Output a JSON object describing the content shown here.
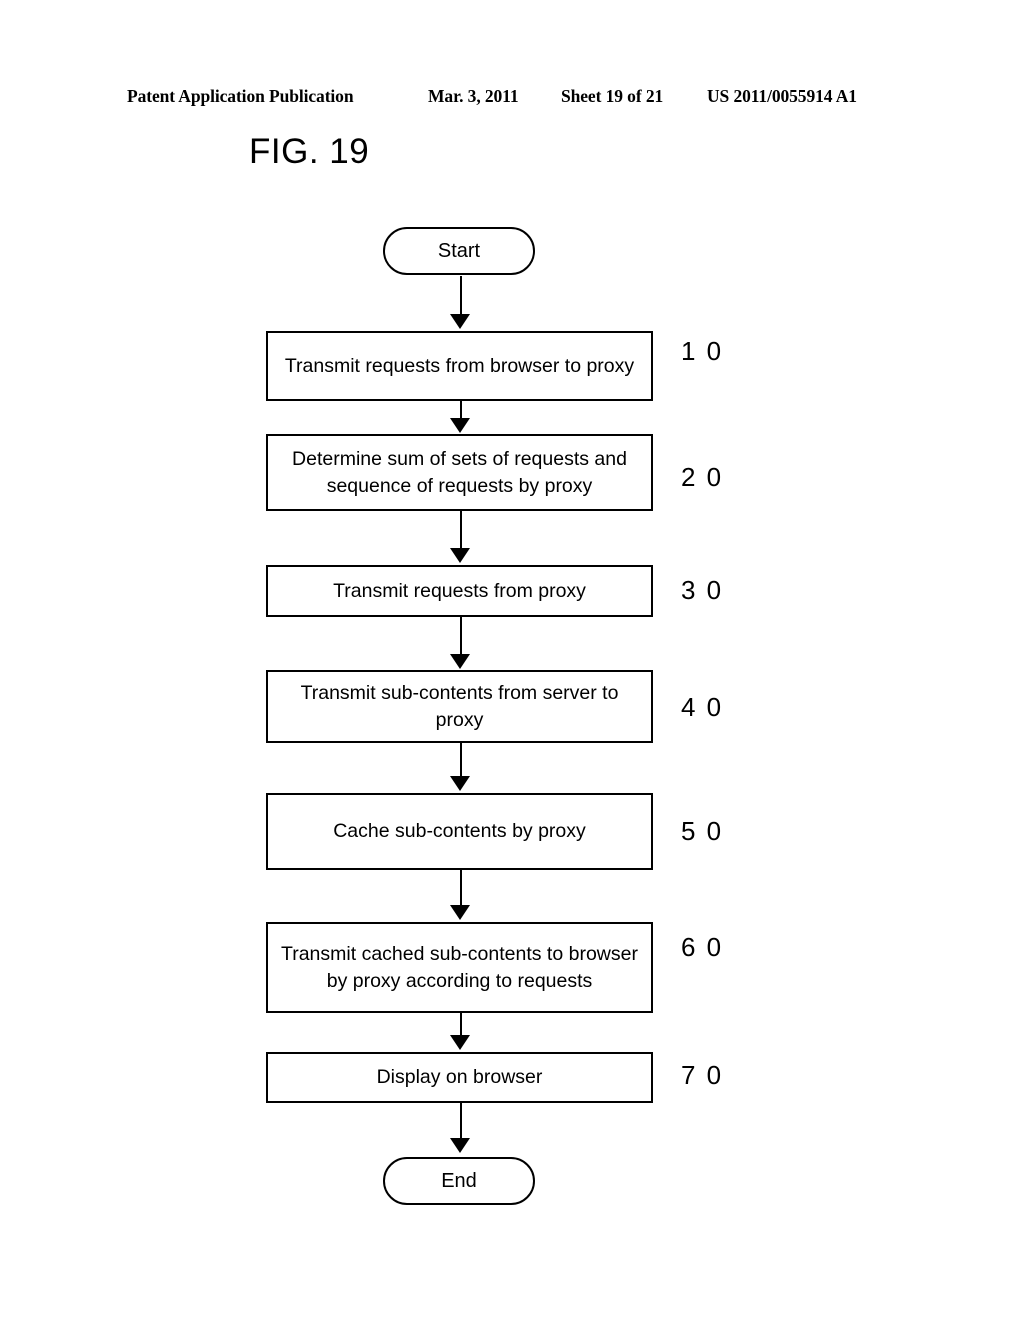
{
  "header": {
    "publication": "Patent Application Publication",
    "date": "Mar. 3, 2011",
    "sheet": "Sheet 19 of 21",
    "patent_number": "US 2011/0055914 A1"
  },
  "figure": {
    "title": "FIG. 19"
  },
  "diagram_data": {
    "type": "flowchart",
    "orientation": "vertical",
    "start_label": "Start",
    "end_label": "End",
    "nodes": [
      {
        "id": "start",
        "shape": "terminal",
        "label": "Start",
        "ref": ""
      },
      {
        "id": "step10",
        "shape": "process",
        "label": "Transmit requests from browser to proxy",
        "ref": "1 0"
      },
      {
        "id": "step20",
        "shape": "process",
        "label": "Determine sum of sets of requests and sequence of requests by proxy",
        "ref": "2 0"
      },
      {
        "id": "step30",
        "shape": "process",
        "label": "Transmit requests from proxy",
        "ref": "3 0"
      },
      {
        "id": "step40",
        "shape": "process",
        "label": "Transmit sub-contents from server to proxy",
        "ref": "4 0"
      },
      {
        "id": "step50",
        "shape": "process",
        "label": "Cache sub-contents by proxy",
        "ref": "5 0"
      },
      {
        "id": "step60",
        "shape": "process",
        "label": "Transmit cached sub-contents to browser by proxy according to requests",
        "ref": "6 0"
      },
      {
        "id": "step70",
        "shape": "process",
        "label": "Display on browser",
        "ref": "7 0"
      },
      {
        "id": "end",
        "shape": "terminal",
        "label": "End",
        "ref": ""
      }
    ],
    "edges": [
      {
        "from": "start",
        "to": "step10"
      },
      {
        "from": "step10",
        "to": "step20"
      },
      {
        "from": "step20",
        "to": "step30"
      },
      {
        "from": "step30",
        "to": "step40"
      },
      {
        "from": "step40",
        "to": "step50"
      },
      {
        "from": "step50",
        "to": "step60"
      },
      {
        "from": "step60",
        "to": "step70"
      },
      {
        "from": "step70",
        "to": "end"
      }
    ],
    "colors": {
      "stroke": "#000000",
      "fill": "#ffffff",
      "text": "#000000"
    }
  }
}
